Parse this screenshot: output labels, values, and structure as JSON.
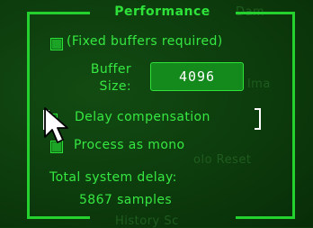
{
  "panel": {
    "title": "Performance"
  },
  "options": {
    "fixed_buffers": {
      "label": "(Fixed buffers required)",
      "checked": false
    },
    "delay_compensation": {
      "label": "Delay compensation",
      "checked": false
    },
    "process_mono": {
      "label": "Process as mono",
      "checked": false
    }
  },
  "buffer": {
    "label_line1": "Buffer",
    "label_line2": "Size:",
    "value": "4096"
  },
  "system_delay": {
    "label": "Total system delay:",
    "value": "5867 samples"
  },
  "colors": {
    "accent": "#2ee23a",
    "background": "#0b3a0b",
    "field": "#14891c"
  },
  "icons": [
    "checkbox-icon",
    "mouse-pointer-icon"
  ]
}
